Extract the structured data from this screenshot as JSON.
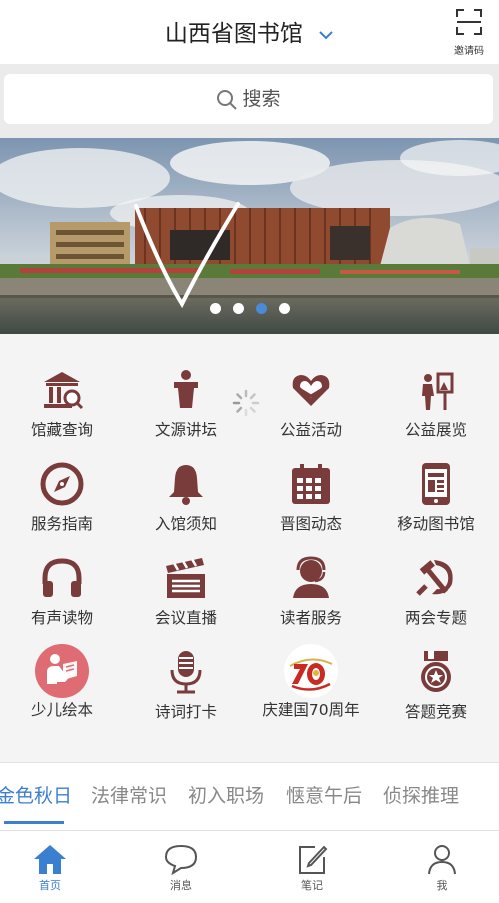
{
  "header": {
    "title": "山西省图书馆",
    "invite_label": "邀请码"
  },
  "search": {
    "placeholder": "搜索"
  },
  "banner": {
    "dots": 4,
    "active_dot": 3
  },
  "grid": {
    "items": [
      {
        "label": "馆藏查询",
        "icon": "library-building-icon"
      },
      {
        "label": "文源讲坛",
        "icon": "lectern-icon"
      },
      {
        "label": "公益活动",
        "icon": "heart-hands-icon"
      },
      {
        "label": "公益展览",
        "icon": "exhibition-icon"
      },
      {
        "label": "服务指南",
        "icon": "compass-icon"
      },
      {
        "label": "入馆须知",
        "icon": "bell-icon"
      },
      {
        "label": "晋图动态",
        "icon": "calendar-icon"
      },
      {
        "label": "移动图书馆",
        "icon": "mobile-book-icon"
      },
      {
        "label": "有声读物",
        "icon": "headphones-icon"
      },
      {
        "label": "会议直播",
        "icon": "clapperboard-icon"
      },
      {
        "label": "读者服务",
        "icon": "customer-service-icon"
      },
      {
        "label": "两会专题",
        "icon": "hammer-sickle-icon"
      },
      {
        "label": "少儿绘本",
        "icon": "child-reading-icon"
      },
      {
        "label": "诗词打卡",
        "icon": "microphone-icon"
      },
      {
        "label": "庆建国70周年",
        "icon": "anniversary-70-icon"
      },
      {
        "label": "答题竞赛",
        "icon": "medal-icon"
      }
    ]
  },
  "tabs": [
    "金色秋日",
    "法律常识",
    "初入职场",
    "惬意午后",
    "侦探推理"
  ],
  "active_tab": 0,
  "bottom_nav": [
    {
      "label": "首页",
      "icon": "home-icon"
    },
    {
      "label": "消息",
      "icon": "message-icon"
    },
    {
      "label": "笔记",
      "icon": "note-icon"
    },
    {
      "label": "我",
      "icon": "user-icon"
    }
  ],
  "colors": {
    "accent": "#3b7fd0",
    "icon_brown": "#7a3b3b",
    "active_dot": "#4a8ad6"
  }
}
